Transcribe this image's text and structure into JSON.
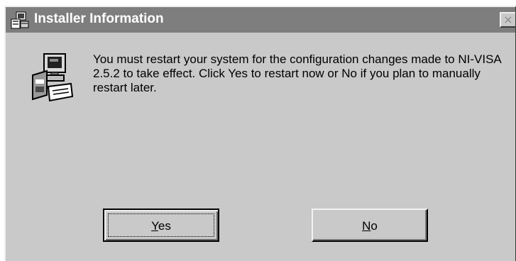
{
  "window": {
    "title": "Installer Information",
    "close_glyph": "×",
    "title_icon": "installer-icon"
  },
  "message": {
    "icon": "computer-setup-icon",
    "text": "You must restart your system for the configuration changes made to NI-VISA 2.5.2 to take effect. Click Yes to restart now or No if you plan to manually restart later."
  },
  "buttons": {
    "yes": {
      "hotkey": "Y",
      "rest": "es"
    },
    "no": {
      "hotkey": "N",
      "rest": "o"
    }
  },
  "colors": {
    "titlebar": "#7e7e7e",
    "face": "#c9c9c9"
  }
}
